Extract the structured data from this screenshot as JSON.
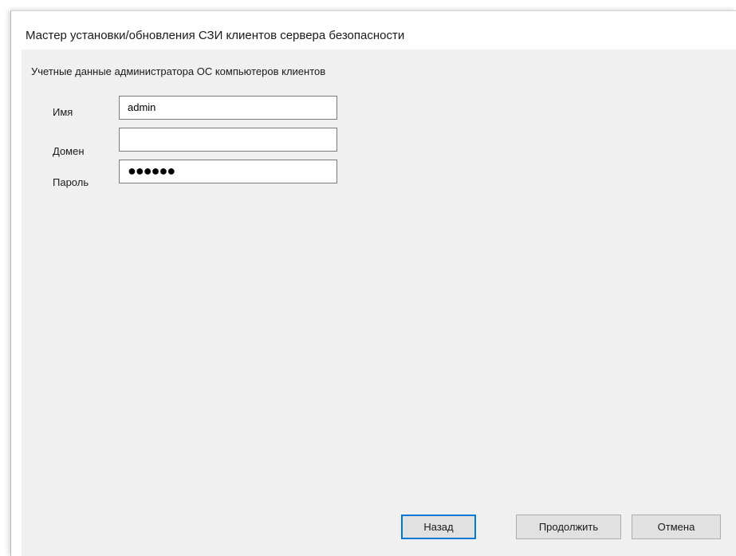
{
  "window": {
    "title": "Мастер установки/обновления СЗИ клиентов сервера безопасности"
  },
  "credentials": {
    "section_title": "Учетные данные администратора ОС компьютеров клиентов",
    "name_label": "Имя",
    "name_value": "admin",
    "domain_label": "Домен",
    "domain_value": "",
    "password_label": "Пароль",
    "password_mask": "●●●●●●"
  },
  "buttons": {
    "back": "Назад",
    "continue": "Продолжить",
    "cancel": "Отмена"
  },
  "colors": {
    "focus_border": "#0078d7",
    "panel_background": "#f0f0f0"
  }
}
